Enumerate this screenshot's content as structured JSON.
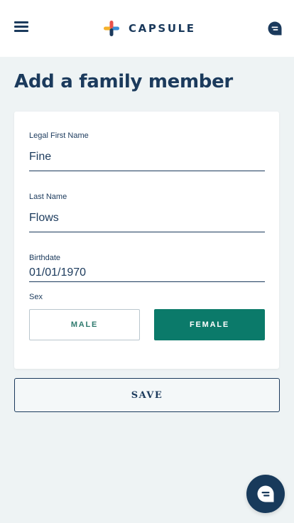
{
  "header": {
    "brand_name": "CAPSULE",
    "menu_icon": "hamburger-menu-icon",
    "chat_icon": "chat-bubble-icon"
  },
  "page": {
    "title": "Add a family member"
  },
  "form": {
    "first_name": {
      "label": "Legal First Name",
      "value": "Fine"
    },
    "last_name": {
      "label": "Last Name",
      "value": "Flows"
    },
    "birthdate": {
      "label": "Birthdate",
      "value": "01/01/1970"
    },
    "sex": {
      "label": "Sex",
      "options": [
        "MALE",
        "FEMALE"
      ],
      "selected": "FEMALE"
    }
  },
  "actions": {
    "save_label": "SAVE"
  },
  "colors": {
    "navy": "#1b3a5c",
    "teal": "#0b7a6a",
    "background": "#eef3f4",
    "logo_yellow": "#f5b12c",
    "logo_red": "#e8524a",
    "logo_blue": "#3a8fd6",
    "logo_navy": "#1b3a5c"
  }
}
